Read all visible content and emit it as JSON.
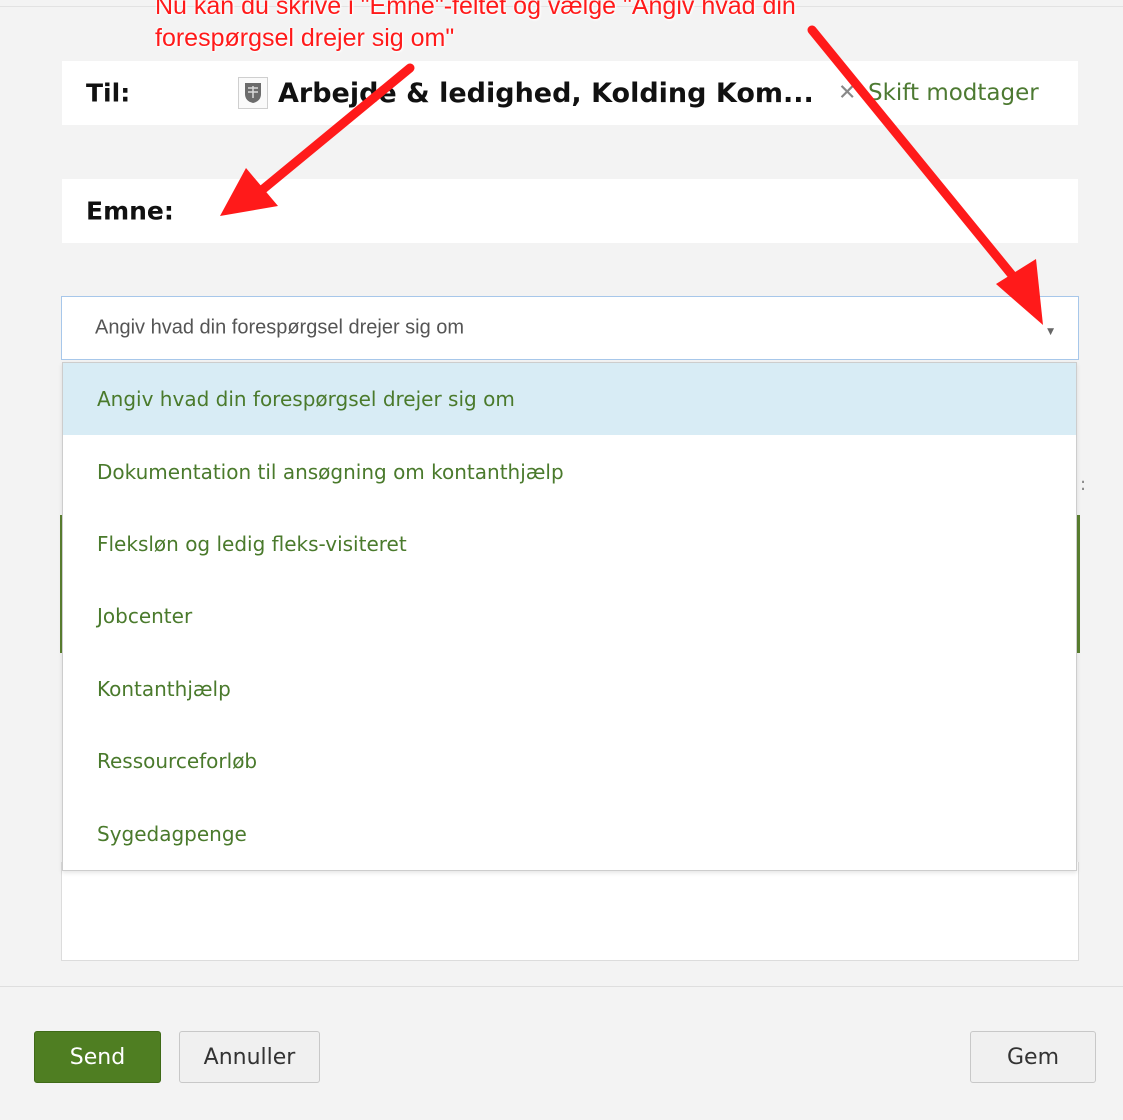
{
  "annotation": {
    "line1": "Nu kan du skrive i \"Emne\"-feltet og vælge \"Angiv hvad din",
    "line2": "forespørgsel drejer sig om\"",
    "color": "#ff1a1a"
  },
  "to_field": {
    "label": "Til:",
    "recipient": "Arbejde & ledighed, Kolding Kom...",
    "remove_icon": "close-icon",
    "change_label": "Skift modtager"
  },
  "subject_field": {
    "label": "Emne:"
  },
  "topic_select": {
    "selected": "Angiv hvad din forespørgsel drejer sig om",
    "options": [
      "Angiv hvad din forespørgsel drejer sig om",
      "Dokumentation til ansøgning om kontanthjælp",
      "Fleksløn og ledig fleks-visiteret",
      "Jobcenter",
      "Kontanthjælp",
      "Ressourceforløb",
      "Sygedagpenge"
    ],
    "highlighted_index": 0
  },
  "buttons": {
    "send": "Send",
    "cancel": "Annuller",
    "save": "Gem"
  },
  "colors": {
    "accent_green": "#4f7e22",
    "link_green": "#4a7a2c",
    "highlight": "#d8ecf5"
  }
}
